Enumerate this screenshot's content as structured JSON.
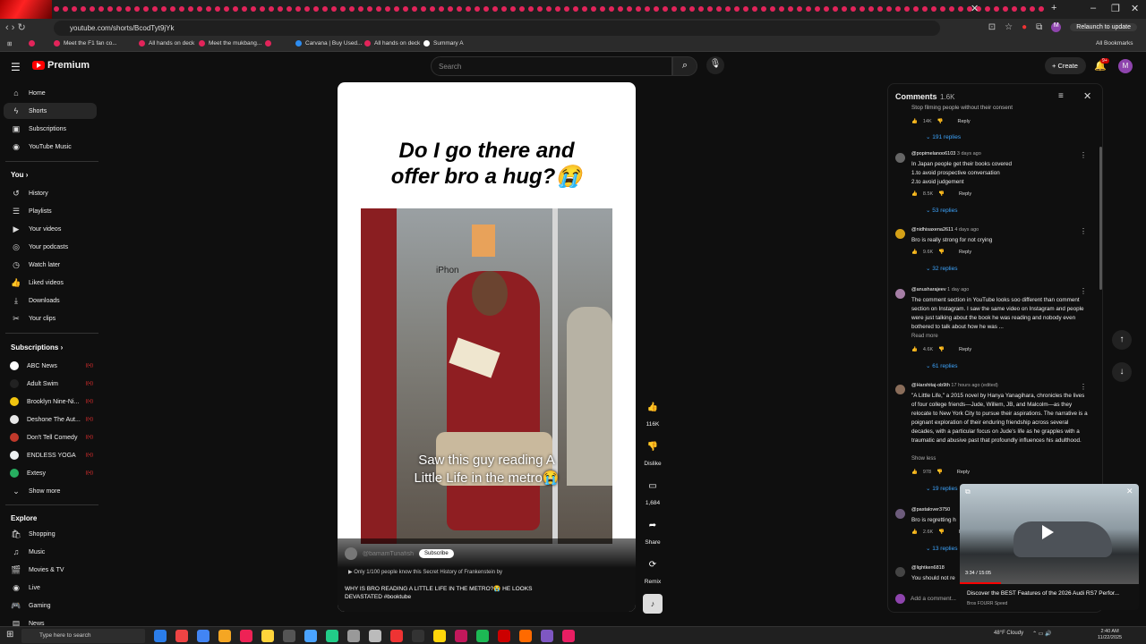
{
  "browser": {
    "url": "youtube.com/shorts/BcodTyt9jYk",
    "relaunch": "Relaunch to update",
    "all_bookmarks": "All Bookmarks",
    "bookmarks": [
      "Meet the F1 fan co...",
      "All hands on deck",
      "Meet the mukbang...",
      "Carvana | Buy Used...",
      "All hands on deck",
      "Summary A"
    ],
    "profile_initial": "M"
  },
  "header": {
    "logo": "Premium",
    "search_placeholder": "Search",
    "create": "Create",
    "notif_count": "9+",
    "avatar": "M"
  },
  "sidebar": {
    "main": [
      {
        "label": "Home",
        "icon": "⌂"
      },
      {
        "label": "Shorts",
        "icon": "ϟ"
      },
      {
        "label": "Subscriptions",
        "icon": "▣"
      },
      {
        "label": "YouTube Music",
        "icon": "◉"
      }
    ],
    "you_heading": "You",
    "you": [
      {
        "label": "History",
        "icon": "↺"
      },
      {
        "label": "Playlists",
        "icon": "☰"
      },
      {
        "label": "Your videos",
        "icon": "▶"
      },
      {
        "label": "Your podcasts",
        "icon": "◎"
      },
      {
        "label": "Watch later",
        "icon": "◷"
      },
      {
        "label": "Liked videos",
        "icon": "👍"
      },
      {
        "label": "Downloads",
        "icon": "⤓"
      },
      {
        "label": "Your clips",
        "icon": "✂"
      }
    ],
    "subs_heading": "Subscriptions",
    "subs": [
      {
        "label": "ABC News",
        "color": "#ffffff"
      },
      {
        "label": "Adult Swim",
        "color": "#222222"
      },
      {
        "label": "Brooklyn Nine-Ni...",
        "color": "#f1c40f"
      },
      {
        "label": "Deshone The Aut...",
        "color": "#e8e8e8"
      },
      {
        "label": "Don't Tell Comedy",
        "color": "#c0392b"
      },
      {
        "label": "ENDLESS YOGA",
        "color": "#ecf0f1"
      },
      {
        "label": "Extesy",
        "color": "#27ae60"
      }
    ],
    "show_more": "Show more",
    "explore_heading": "Explore",
    "explore": [
      {
        "label": "Shopping",
        "icon": "🛍"
      },
      {
        "label": "Music",
        "icon": "♫"
      },
      {
        "label": "Movies & TV",
        "icon": "🎬"
      },
      {
        "label": "Live",
        "icon": "◉"
      },
      {
        "label": "Gaming",
        "icon": "🎮"
      },
      {
        "label": "News",
        "icon": "▤"
      }
    ]
  },
  "short": {
    "title_line1": "Do I go there and",
    "title_line2": "offer bro a hug?😭",
    "poster_text": "iPhon",
    "caption_line1": "Saw this guy reading A",
    "caption_line2": "Little Life in the metro😭",
    "channel": "@bamamTunafish",
    "subscribe": "Subscribe",
    "related": "Only 1/100 people know this Secret History of Frankenstein by",
    "description": "WHY IS BRO READING A LITTLE LIFE IN THE METRO?😭 HE LOOKS DEVASTATED #booktube"
  },
  "actions": {
    "like_count": "116K",
    "dislike": "Dislike",
    "comments": "1,684",
    "share": "Share",
    "remix": "Remix"
  },
  "comments": {
    "title": "Comments",
    "count": "1.6K",
    "add_placeholder": "Add a comment...",
    "top_likes": "14K",
    "top_replies": "191 replies",
    "top_partial": "Stop filming people without their consent",
    "items": [
      {
        "author": "@popimelanoo6103",
        "age": "3 days ago",
        "text": "In Japan people get their books covered\n1.to avoid prospective conversation\n2.to avoid judgement",
        "likes": "8.5K",
        "replies": "53 replies",
        "color": "#666666"
      },
      {
        "author": "@nidhisaxena2611",
        "age": "4 days ago",
        "text": "Bro is really strong for not crying",
        "likes": "9.6K",
        "replies": "32 replies",
        "color": "#d4a017"
      },
      {
        "author": "@anusharajeev",
        "age": "1 day ago",
        "text": "The comment section in YouTube looks soo different than comment section on Instagram. I saw the same video on Instagram and people were just talking about the book he was reading and nobody even bothered to talk about how he was ...",
        "more": "Read more",
        "likes": "4.6K",
        "replies": "61 replies",
        "color": "#a57ea5"
      },
      {
        "author": "@Harshitaj-ob9th",
        "age": "17 hours ago (edited)",
        "text": "\"A Little Life,\" a 2015 novel by Hanya Yanagihara, chronicles the lives of four college friends—Jude, Willem, JB, and Malcolm—as they relocate to New York City to pursue their aspirations. The narrative is a poignant exploration of their enduring friendship across several decades, with a particular focus on Jude's life as he grapples with a traumatic and abusive past that profoundly influences his adulthood.",
        "more": "Show less",
        "likes": "978",
        "replies": "19 replies",
        "color": "#8a6d5a"
      },
      {
        "author": "@pastalover3750",
        "age": "",
        "text": "Bro is regretting h",
        "likes": "2.6K",
        "replies": "13 replies",
        "color": "#6c5b7b"
      },
      {
        "author": "@lightken6818",
        "age": "",
        "text": "You should not re",
        "likes": "",
        "replies": "",
        "color": "#444444"
      }
    ],
    "reply": "Reply"
  },
  "mini_player": {
    "time": "3:34 / 15:05",
    "title": "Discover the BEST Features of the 2026 Audi RS7 Perfor...",
    "channel": "Bros FOURR Speed"
  },
  "taskbar": {
    "search": "Type here to search",
    "weather": "48°F  Cloudy",
    "time": "2:40 AM",
    "date": "11/22/2025"
  }
}
